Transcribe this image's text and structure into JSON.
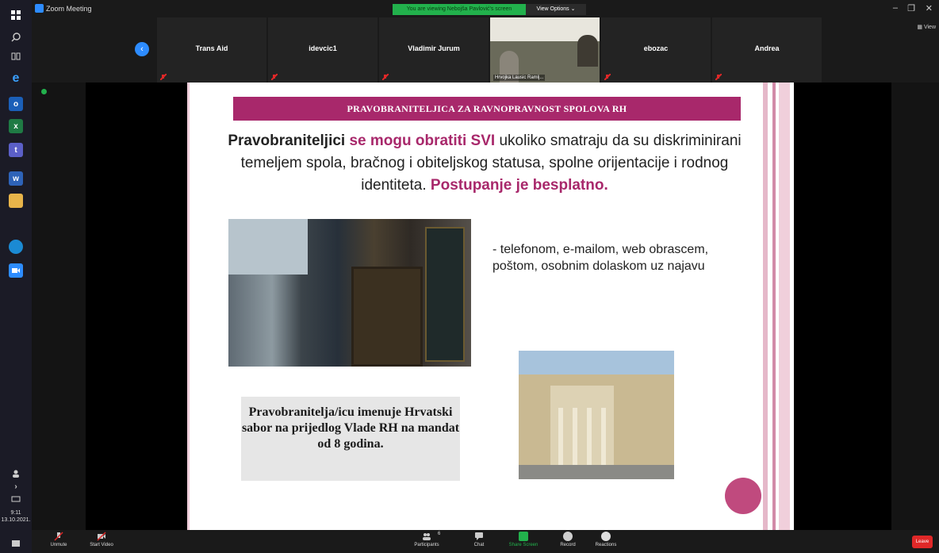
{
  "window": {
    "title": "Zoom Meeting",
    "viewing_banner": "You are viewing Nebojša Pavlović's screen",
    "view_options": "View Options ⌄",
    "view_button": "View"
  },
  "participants": [
    {
      "name": "Trans Aid"
    },
    {
      "name": "idevcic1"
    },
    {
      "name": "Vladimir Jurum"
    },
    {
      "name": "Hrvojka Lausic Ramlj..."
    },
    {
      "name": "ebozac"
    },
    {
      "name": "Andrea"
    }
  ],
  "slide": {
    "header": "PRAVOBRANITELJICA ZA RAVNOPRAVNOST SPOLOVA RH",
    "main_part1": "Pravobraniteljici",
    "main_part2": " se mogu obratiti SVI",
    "main_part3": " ukoliko smatraju da su diskriminirani temeljem spola, bračnog i obiteljskog statusa, spolne orijentacije i rodnog identiteta.",
    "main_part4": " Postupanje je besplatno.",
    "contact": "- telefonom, e-mailom, web obrascem, poštom, osobnim dolaskom  uz najavu",
    "box": "Pravobranitelja/icu imenuje Hrvatski sabor na prijedlog Vlade RH na mandat od 8 godina."
  },
  "toolbar": {
    "unmute": "Unmute",
    "start_video": "Start Video",
    "participants": "Participants",
    "participants_count": "6",
    "chat": "Chat",
    "share_screen": "Share Screen",
    "record": "Record",
    "reactions": "Reactions",
    "leave": "Leave"
  },
  "clock": {
    "time": "9:11",
    "date": "13.10.2021."
  },
  "colors": {
    "accent": "#a8286b",
    "zoom_blue": "#2d8cff",
    "banner_green": "#22b14c",
    "leave_red": "#e02828"
  }
}
